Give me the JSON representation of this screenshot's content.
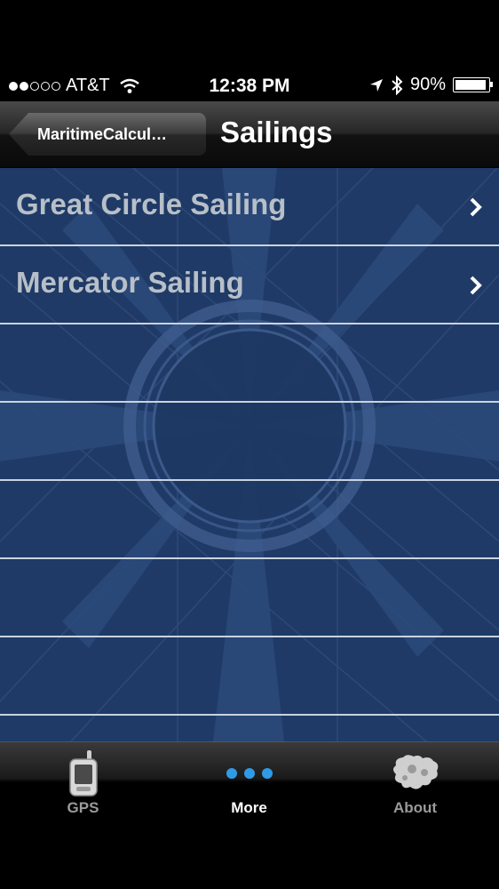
{
  "status_bar": {
    "carrier": "AT&T",
    "signal_dots_filled": 2,
    "signal_dots_total": 5,
    "time": "12:38 PM",
    "battery": "90%",
    "battery_level": 0.9
  },
  "nav": {
    "back_label": "MaritimeCalcul…",
    "title": "Sailings"
  },
  "list": {
    "items": [
      {
        "label": "Great Circle Sailing",
        "chevron": "chevron-right-icon"
      },
      {
        "label": "Mercator Sailing",
        "chevron": "chevron-right-icon"
      },
      {
        "label": ""
      },
      {
        "label": ""
      },
      {
        "label": ""
      },
      {
        "label": ""
      },
      {
        "label": ""
      }
    ]
  },
  "tab_bar": {
    "tabs": [
      {
        "label": "GPS",
        "icon": "gps-device-icon",
        "active": false
      },
      {
        "label": "More",
        "icon": "more-dots-icon",
        "active": true
      },
      {
        "label": "About",
        "icon": "world-map-icon",
        "active": false
      }
    ]
  },
  "colors": {
    "list_background": "#1f3a66",
    "row_text": "#b7bfc8",
    "separator": "#c9d3e0",
    "active_dots": "#2f9be6"
  }
}
